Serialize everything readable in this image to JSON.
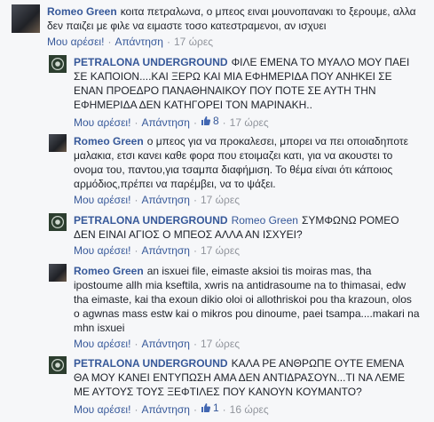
{
  "comments": [
    {
      "author": "Romeo Green",
      "mention": "",
      "text": "κοιτα πετραλωνα, ο μπεος ειναι μουνοπανακι το ξερουμε, αλλα δεν παιζει με φιλε να ειμαστε τοσο κατεστραμενοι, αν ισχυει",
      "like_label": "Μου αρέσει!",
      "reply_label": "Απάντηση",
      "likes": "",
      "time": "17 ώρες"
    },
    {
      "author": "PETRALONA UNDERGROUND",
      "mention": "",
      "text": "ΦΙΛΕ ΕΜΕΝΑ ΤΟ ΜΥΑΛΟ ΜΟΥ ΠΑΕΙ ΣΕ ΚΑΠΟΙΟΝ....ΚΑΙ ΞΕΡΩ ΚΑΙ ΜΙΑ ΕΦΗΜΕΡΙΔΑ ΠΟΥ ΑΝΗΚΕΙ ΣΕ ΕΝΑΝ ΠΡΟΕΔΡΟ ΠΑΝΑΘΗΝΑΙΚΟΥ ΠΟΥ ΠΟΤΕ ΣΕ ΑΥΤΗ ΤΗΝ ΕΦΗΜΕΡΙΔΑ ΔΕΝ ΚΑΤΗΓΟΡΕΙ ΤΟΝ ΜΑΡΙΝΑΚΗ..",
      "like_label": "Μου αρέσει!",
      "reply_label": "Απάντηση",
      "likes": "8",
      "time": "17 ώρες"
    },
    {
      "author": "Romeo Green",
      "mention": "",
      "text": "ο μπεος για να προκαλεσει, μπορει να πει οποιαδηποτε μαλακια, ετσι κανει καθε φορα που ετοιμαζει κατι, για να ακουστει το ονομα του, παντου,για τσαμπα διαφήμιση. Το θέμα είναι ότι κάποιος αρμόδιος,πρέπει να παρέμβει, να το ψάξει.",
      "like_label": "Μου αρέσει!",
      "reply_label": "Απάντηση",
      "likes": "",
      "time": "17 ώρες"
    },
    {
      "author": "PETRALONA UNDERGROUND",
      "mention": "Romeo Green",
      "text": "ΣΥΜΦΩΝΩ ΡΟΜΕΟ ΔΕΝ ΕΙΝΑΙ ΑΓΙΟΣ Ο ΜΠΕΟΣ ΑΛΛΑ ΑΝ ΙΣΧΥΕΙ?",
      "like_label": "Μου αρέσει!",
      "reply_label": "Απάντηση",
      "likes": "",
      "time": "17 ώρες"
    },
    {
      "author": "Romeo Green",
      "mention": "",
      "text": "an isxuei file, eimaste aksioi tis moiras mas, tha ipostoume allh mia kseftila, xwris na antidrasoume na to thimasai, edw tha eimaste, kai tha exoun dikio oloi oi allothriskoi pou tha krazoun, olos o agwnas mass estw kai o mikros pou dinoume, paei tsampa....makari na mhn isxuei",
      "like_label": "Μου αρέσει!",
      "reply_label": "Απάντηση",
      "likes": "",
      "time": "17 ώρες"
    },
    {
      "author": "PETRALONA UNDERGROUND",
      "mention": "",
      "text": "ΚΑΛΑ ΡΕ ΑΝΘΡΩΠΕ ΟΥΤΕ ΕΜΕΝΑ ΘΑ ΜΟΥ ΚΑΝΕΙ ΕΝΤΥΠΩΣΗ ΑΜΑ ΔΕΝ ΑΝΤΙΔΡΑΣΟΥΝ...ΤΙ ΝΑ ΛΕΜΕ ΜΕ ΑΥΤΟΥΣ ΤΟΥΣ ΞΕΦΤΙΛΕΣ ΠΟΥ ΚΑΝΟΥΝ ΚΟΥΜΑΝΤΟ?",
      "like_label": "Μου αρέσει!",
      "reply_label": "Απάντηση",
      "likes": "1",
      "time": "16 ώρες"
    }
  ]
}
